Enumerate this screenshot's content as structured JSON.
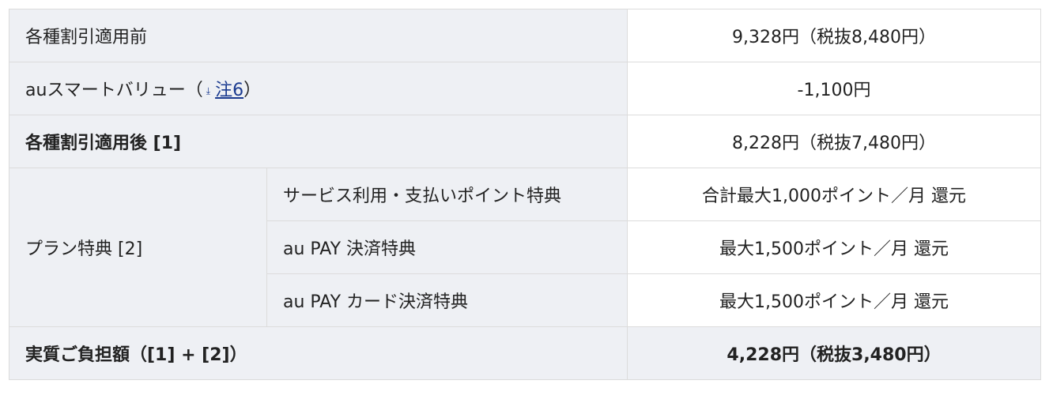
{
  "rows": {
    "before_discount": {
      "label": "各種割引適用前",
      "value": "9,328円（税抜8,480円）"
    },
    "au_smart_value": {
      "label_prefix": "auスマートバリュー（",
      "note_link": "注6",
      "label_suffix": "）",
      "note_icon": "download-arrow-icon",
      "value": "-1,100円"
    },
    "after_discount": {
      "label": "各種割引適用後 [1]",
      "value": "8,228円（税抜7,480円）"
    },
    "plan_benefits": {
      "label": "プラン特典 [2]",
      "items": [
        {
          "label": "サービス利用・支払いポイント特典",
          "value": "合計最大1,000ポイント／月 還元"
        },
        {
          "label": "au PAY 決済特典",
          "value": "最大1,500ポイント／月 還元"
        },
        {
          "label": "au PAY カード決済特典",
          "value": "最大1,500ポイント／月 還元"
        }
      ]
    },
    "effective_total": {
      "label": "実質ご負担額（[1] + [2]）",
      "value": "4,228円（税抜3,480円）"
    }
  }
}
